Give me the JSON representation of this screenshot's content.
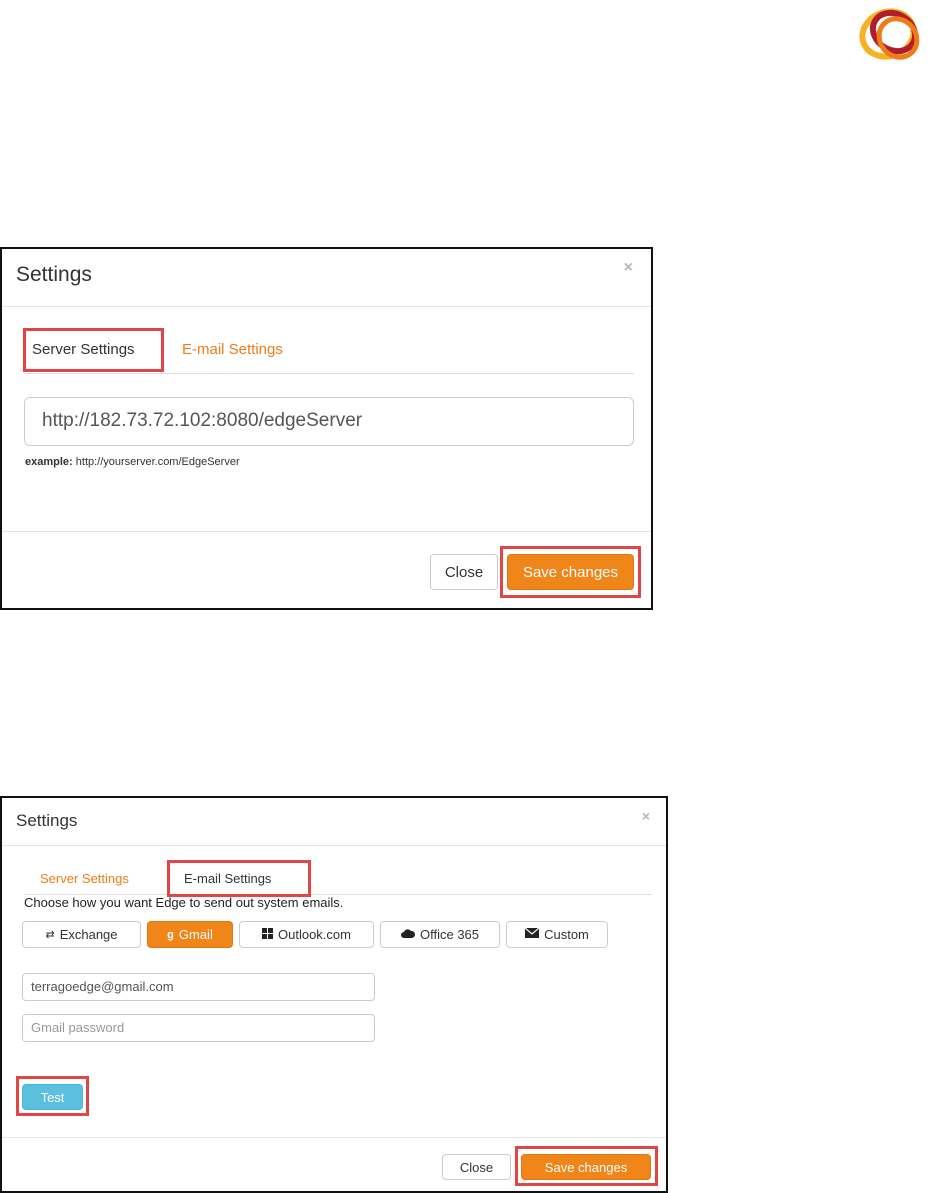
{
  "colors": {
    "accent_orange": "#f08519",
    "highlight_red": "#e04646",
    "info_blue": "#5bc0de",
    "logo_red": "#b01e2e",
    "logo_orange": "#f07c17",
    "logo_yellow": "#f5b323"
  },
  "logo": {
    "icon": "brand-logo-icon"
  },
  "dialog_server": {
    "title": "Settings",
    "close_glyph": "×",
    "tabs": [
      {
        "label": "Server Settings",
        "active": true
      },
      {
        "label": "E-mail Settings",
        "active": false
      }
    ],
    "server_url_value": "http://182.73.72.102:8080/edgeServer",
    "example_label": "example:",
    "example_text": "http://yourserver.com/EdgeServer",
    "close_button": "Close",
    "save_button": "Save changes"
  },
  "dialog_email": {
    "title": "Settings",
    "close_glyph": "×",
    "tabs": [
      {
        "label": "Server Settings",
        "active": false
      },
      {
        "label": "E-mail Settings",
        "active": true
      }
    ],
    "instruction": "Choose how you want Edge to send out system emails.",
    "providers": [
      {
        "label": "Exchange",
        "icon": "exchange-icon",
        "selected": false
      },
      {
        "label": "Gmail",
        "icon": "google-icon",
        "selected": true
      },
      {
        "label": "Outlook.com",
        "icon": "windows-icon",
        "selected": false
      },
      {
        "label": "Office 365",
        "icon": "cloud-icon",
        "selected": false
      },
      {
        "label": "Custom",
        "icon": "envelope-icon",
        "selected": false
      }
    ],
    "email_value": "terragoedge@gmail.com",
    "password_placeholder": "Gmail password",
    "test_button": "Test",
    "close_button": "Close",
    "save_button": "Save changes"
  }
}
